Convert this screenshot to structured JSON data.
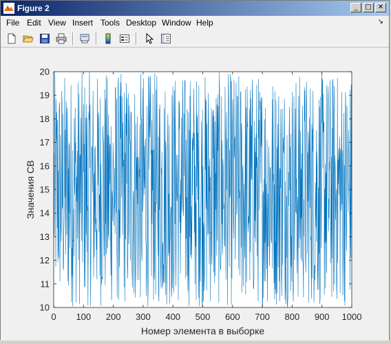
{
  "window": {
    "title": "Figure 2"
  },
  "menu": [
    "File",
    "Edit",
    "View",
    "Insert",
    "Tools",
    "Desktop",
    "Window",
    "Help"
  ],
  "toolbar": [
    "new-figure",
    "open-file",
    "save",
    "print",
    "print-preview",
    "insert-colorbar",
    "insert-legend",
    "edit-plot",
    "show-plot-tools"
  ],
  "colors": {
    "line": "#0072bd",
    "titlebar_start": "#0a246a",
    "titlebar_end": "#a6caf0",
    "figure_bg": "#f0f0f0"
  },
  "chart_data": {
    "type": "line",
    "xlabel": "Номер элемента в выборке",
    "ylabel": "Значения СВ",
    "xlim": [
      0,
      1000
    ],
    "ylim": [
      10,
      20
    ],
    "xticks": [
      0,
      100,
      200,
      300,
      400,
      500,
      600,
      700,
      800,
      900,
      1000
    ],
    "yticks": [
      10,
      11,
      12,
      13,
      14,
      15,
      16,
      17,
      18,
      19,
      20
    ],
    "grid": false,
    "series": [
      {
        "distribution": "uniform",
        "n_points": 1000,
        "min": 10,
        "max": 20
      }
    ]
  }
}
